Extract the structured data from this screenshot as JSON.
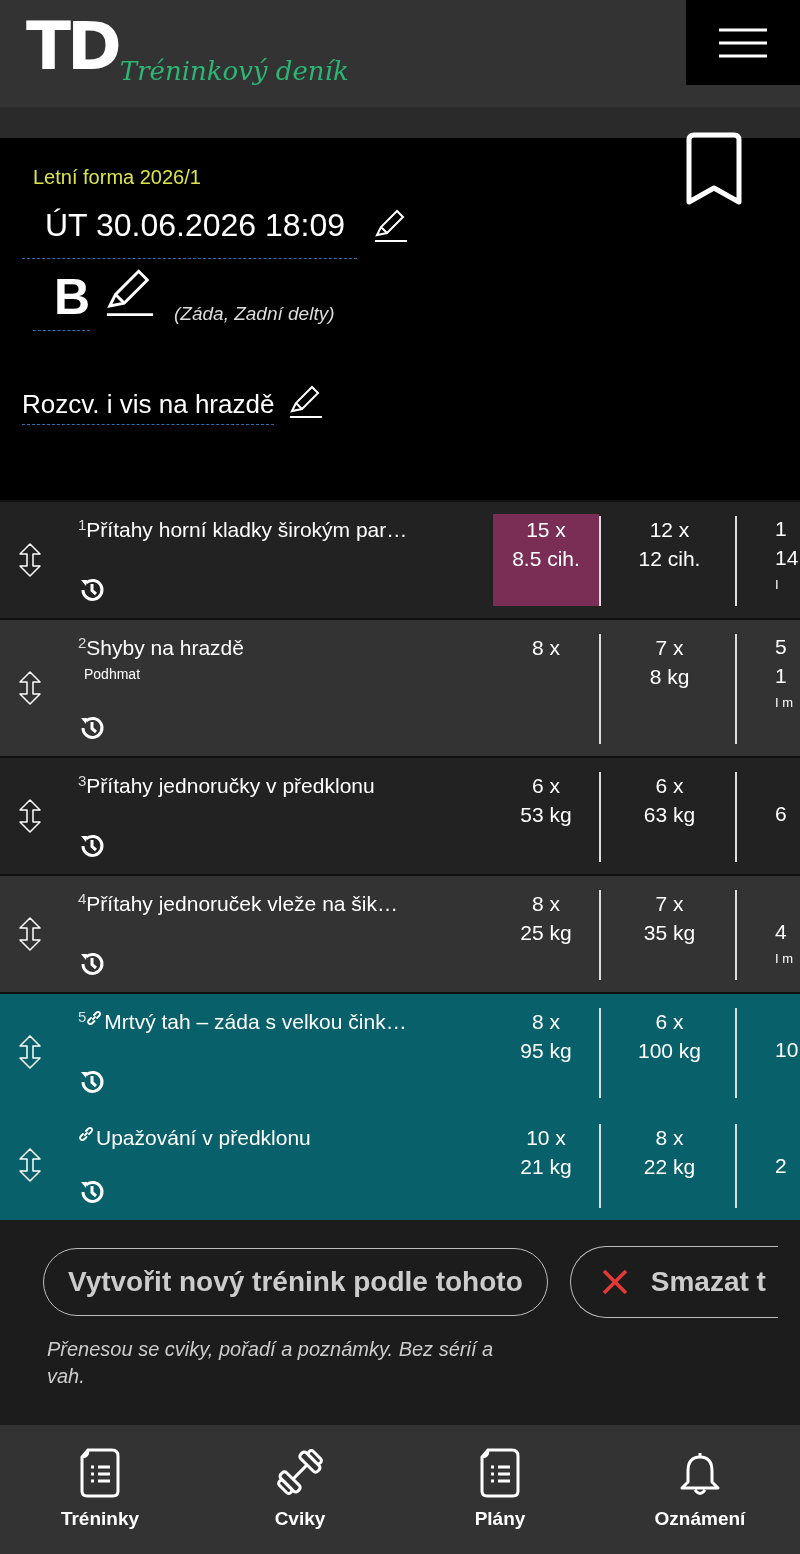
{
  "header": {
    "logo_mark": "TD",
    "logo_text": "Tréninkový deník"
  },
  "workout": {
    "plan": "Letní forma 2026/1",
    "datetime": "ÚT 30.06.2026 18:09",
    "variant": "B",
    "muscles": "(Záda, Zadní delty)",
    "note": "Rozcv. i vis na hrazdě"
  },
  "exercises": [
    {
      "number": "1",
      "name": "Přítahy horní kladky širokým par…",
      "linked": false,
      "superset": false,
      "sets": [
        {
          "reps": "15 x",
          "weight": "8.5 cih.",
          "highlighted": true
        },
        {
          "reps": "12 x",
          "weight": "12 cih.",
          "highlighted": false
        }
      ],
      "column_3": {
        "line_1": "1",
        "line_2": "14",
        "note": "I"
      }
    },
    {
      "number": "2",
      "name": "Shyby na hrazdě",
      "subtitle": "Podhmat",
      "linked": false,
      "superset": false,
      "sets": [
        {
          "reps": "8 x",
          "highlighted": false
        },
        {
          "reps": "7 x",
          "weight": "8 kg",
          "highlighted": false
        }
      ],
      "column_3": {
        "line_1": "5",
        "line_2": "1",
        "note": "I m"
      }
    },
    {
      "number": "3",
      "name": "Přítahy jednoručky v předklonu",
      "linked": false,
      "superset": false,
      "sets": [
        {
          "reps": "6 x",
          "weight": "53 kg",
          "highlighted": false
        },
        {
          "reps": "6 x",
          "weight": "63 kg",
          "highlighted": false
        }
      ],
      "column_3": {
        "line_2": "6"
      }
    },
    {
      "number": "4",
      "name": "Přítahy jednoruček vleže na šik…",
      "linked": false,
      "superset": false,
      "sets": [
        {
          "reps": "8 x",
          "weight": "25 kg",
          "highlighted": false
        },
        {
          "reps": "7 x",
          "weight": "35 kg",
          "highlighted": false
        }
      ],
      "column_3": {
        "line_2": "4",
        "note": "I m"
      }
    },
    {
      "number": "5",
      "name": "Mrtvý tah – záda s velkou čink…",
      "linked": true,
      "superset": true,
      "sets": [
        {
          "reps": "8 x",
          "weight": "95 kg",
          "highlighted": false
        },
        {
          "reps": "6 x",
          "weight": "100 kg",
          "highlighted": false
        }
      ],
      "column_3": {
        "line_2": "10"
      }
    },
    {
      "name": "Upažování v předklonu",
      "linked": true,
      "superset": true,
      "sets": [
        {
          "reps": "10 x",
          "weight": "21 kg",
          "highlighted": false
        },
        {
          "reps": "8 x",
          "weight": "22 kg",
          "highlighted": false
        }
      ],
      "column_3": {
        "line_2": "2"
      }
    }
  ],
  "actions": {
    "copy_button": "Vytvořit nový trénink podle tohoto",
    "delete_button": "Smazat t",
    "hint": "Přenesou se cviky, pořadí a poznámky. Bez sérií a vah."
  },
  "nav": [
    {
      "label": "Tréninky",
      "kind": "list"
    },
    {
      "label": "Cviky",
      "kind": "exercise"
    },
    {
      "label": "Plány",
      "kind": "list"
    },
    {
      "label": "Oznámení",
      "kind": "alert"
    }
  ]
}
